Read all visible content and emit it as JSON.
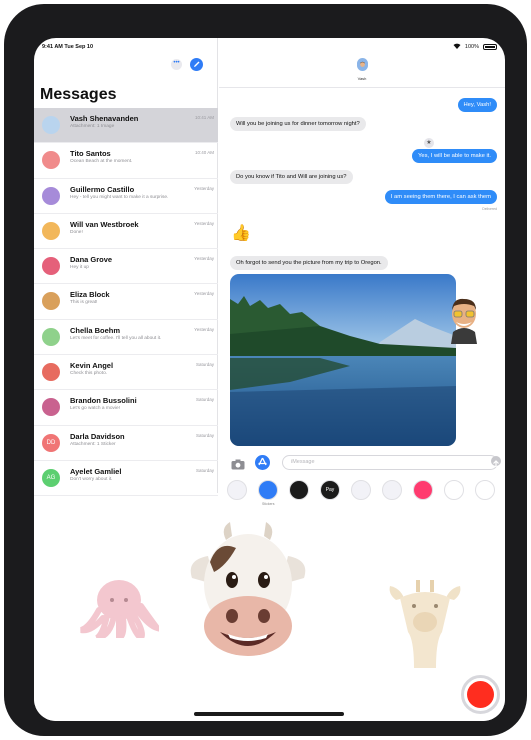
{
  "status_bar": {
    "time": "9:41 AM  Tue Sep 10",
    "battery": "100%"
  },
  "sidebar": {
    "title": "Messages",
    "conversations": [
      {
        "name": "Vash Shenavanden",
        "time": "10:41 AM",
        "preview": "Attachment: 1 Image",
        "avatar_color": "#b9d4ee"
      },
      {
        "name": "Tito Santos",
        "time": "10:40 AM",
        "preview": "Ocean Beach at the moment.",
        "avatar_color": "#f08b8b"
      },
      {
        "name": "Guillermo Castillo",
        "time": "Yesterday",
        "preview": "Hey - tell you might want to make it a surprise.",
        "avatar_color": "#a68bd9"
      },
      {
        "name": "Will van Westbroek",
        "time": "Yesterday",
        "preview": "Done!",
        "avatar_color": "#f2b75a"
      },
      {
        "name": "Dana Grove",
        "time": "Yesterday",
        "preview": "Hey it up",
        "avatar_color": "#e5607a"
      },
      {
        "name": "Eliza Block",
        "time": "Yesterday",
        "preview": "This is great!",
        "avatar_color": "#d9a05b"
      },
      {
        "name": "Chella Boehm",
        "time": "Yesterday",
        "preview": "Let's meet for coffee. I'll tell you all about it.",
        "avatar_color": "#8fd18b"
      },
      {
        "name": "Kevin Angel",
        "time": "Saturday",
        "preview": "Check this photo.",
        "avatar_color": "#e76b5f"
      },
      {
        "name": "Brandon Bussolini",
        "time": "Saturday",
        "preview": "Let's go watch a movie!",
        "avatar_color": "#c9628f"
      },
      {
        "name": "Darla Davidson",
        "time": "Saturday",
        "preview": "Attachment: 1 Sticker",
        "avatar_color": "#f07575",
        "initials": "DD"
      },
      {
        "name": "Ayelet Gamliel",
        "time": "Saturday",
        "preview": "Don't worry about it.",
        "avatar_color": "#5ccf70",
        "initials": "AG"
      }
    ]
  },
  "chat": {
    "contact_name": "Vash",
    "messages": [
      {
        "dir": "out",
        "text": "Hey, Vash!"
      },
      {
        "dir": "in",
        "text": "Will you be joining us for dinner tomorrow night?"
      },
      {
        "dir": "out",
        "text": "Yes, I will be able to make it."
      },
      {
        "dir": "in",
        "text": "Do you know if Tito and Will are joining us?"
      },
      {
        "dir": "out",
        "text": "I am seeing them there, I can ask them"
      },
      {
        "dir": "in",
        "text": "Oh forgot to send you the picture from my trip to Oregon."
      }
    ],
    "delivered": "Delivered",
    "thumbs": "👍",
    "input_placeholder": "iMessage"
  },
  "app_drawer": {
    "caption": "Stickers",
    "apps": [
      {
        "name": "photos-app",
        "color": "#f2f2f7"
      },
      {
        "name": "app-store-app",
        "color": "#2f7cf6"
      },
      {
        "name": "digital-touch-app",
        "color": "#1a1a1a"
      },
      {
        "name": "apple-pay-app",
        "color": "#1a1a1a",
        "label": "Pay"
      },
      {
        "name": "memoji-stickers-app",
        "color": "#f2f2f7"
      },
      {
        "name": "animoji-app",
        "color": "#f2f2f7"
      },
      {
        "name": "search-images-app",
        "color": "#ff3b6f"
      },
      {
        "name": "music-app",
        "color": "#ffffff"
      },
      {
        "name": "more-app",
        "color": "#ffffff"
      }
    ]
  }
}
